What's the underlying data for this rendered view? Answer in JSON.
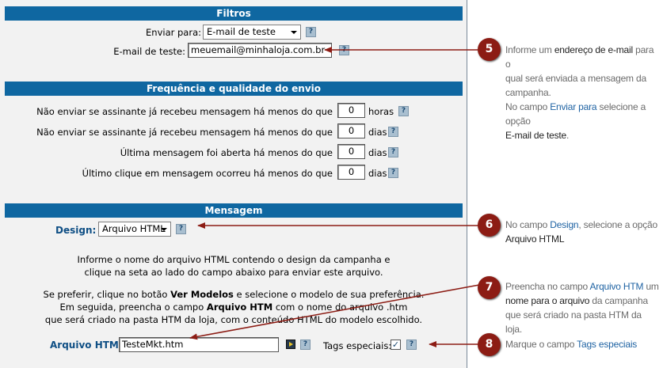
{
  "filtros": {
    "header": "Filtros",
    "enviar_para_label": "Enviar para:",
    "enviar_para_value": "E-mail de teste",
    "email_teste_label": "E-mail de teste:",
    "email_teste_value": "meuemail@minhaloja.com.br"
  },
  "frequencia": {
    "header": "Frequência e qualidade do envio",
    "rows": [
      {
        "label": "Não enviar se assinante já recebeu mensagem há menos do que",
        "value": "0",
        "unit": "horas"
      },
      {
        "label": "Não enviar se assinante já recebeu mensagem há menos do que",
        "value": "0",
        "unit": "dias"
      },
      {
        "label": "Última mensagem foi aberta há menos do que",
        "value": "0",
        "unit": "dias"
      },
      {
        "label": "Último clique em mensagem ocorreu há menos do que",
        "value": "0",
        "unit": "dias"
      }
    ]
  },
  "mensagem": {
    "header": "Mensagem",
    "design_label": "Design:",
    "design_value": "Arquivo HTML",
    "info_line1": "Informe o nome do arquivo HTML contendo o design da campanha e",
    "info_line2": "clique na seta ao lado do campo abaixo para enviar este arquivo.",
    "pref_line1_a": "Se preferir, clique no botão ",
    "pref_line1_b": "Ver Modelos",
    "pref_line1_c": " e selecione o modelo de sua preferência.",
    "pref_line2_a": "Em seguida, preencha o campo ",
    "pref_line2_b": "Arquivo HTM",
    "pref_line2_c": " com o nome do arquivo .htm",
    "pref_line3": "que será criado na pasta HTM da loja, com o conteúdo HTML do modelo escolhido.",
    "arquivo_label": "Arquivo HTM:",
    "arquivo_value": "TesteMkt.htm",
    "tags_label": "Tags especiais:",
    "tags_checked": "✓"
  },
  "help_glyph": "?",
  "callouts": [
    {
      "num": "5",
      "t1": "Informe um ",
      "t2": "endereço de e-mail",
      "t3": " para o",
      "l2": "qual será enviada a mensagem da",
      "l3": "campanha.",
      "l4a": "No campo ",
      "l4b": "Enviar para",
      "l4c": " selecione a opção",
      "l5": "E-mail de teste",
      "l5b": "."
    },
    {
      "num": "6",
      "t1": "No campo ",
      "t2": "Design",
      "t3": ", selecione a opção",
      "l2": "Arquivo HTML"
    },
    {
      "num": "7",
      "t1": "Preencha no campo ",
      "t2": "Arquivo HTM",
      "t3": " um",
      "l2a": "nome para o arquivo",
      "l2b": " da campanha",
      "l3": "que será criado na pasta HTM da loja."
    },
    {
      "num": "8",
      "t1": "Marque o campo ",
      "t2": "Tags especiais"
    }
  ],
  "colors": {
    "header_bar": "#0f67a1",
    "callout": "#8c1c14",
    "arrow": "#8c1c14",
    "link_blue": "#1f63a3"
  }
}
